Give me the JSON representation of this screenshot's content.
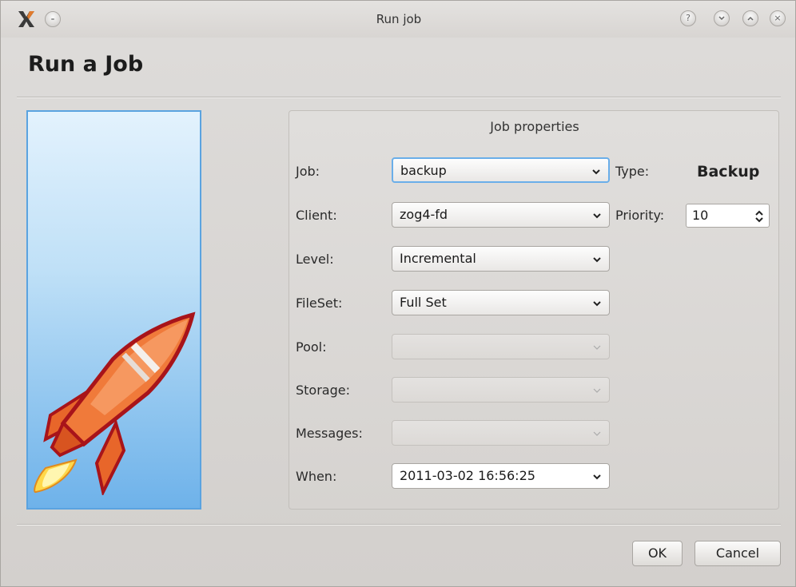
{
  "window": {
    "title": "Run job",
    "controls": [
      "help-icon",
      "minimize-icon",
      "maximize-icon",
      "close-icon"
    ],
    "help_glyph": "?",
    "close_glyph": "×"
  },
  "heading": "Run a Job",
  "properties": {
    "title": "Job properties",
    "job": {
      "label": "Job:",
      "value": "backup"
    },
    "type": {
      "label": "Type:",
      "value": "Backup"
    },
    "client": {
      "label": "Client:",
      "value": "zog4-fd"
    },
    "priority": {
      "label": "Priority:",
      "value": "10"
    },
    "level": {
      "label": "Level:",
      "value": "Incremental"
    },
    "fileset": {
      "label": "FileSet:",
      "value": "Full Set"
    },
    "pool": {
      "label": "Pool:",
      "value": ""
    },
    "storage": {
      "label": "Storage:",
      "value": ""
    },
    "messages": {
      "label": "Messages:",
      "value": ""
    },
    "when": {
      "label": "When:",
      "value": "2011-03-02 16:56:25"
    }
  },
  "buttons": {
    "ok": "OK",
    "cancel": "Cancel"
  },
  "colors": {
    "focus": "#6aaee9",
    "side_panel": "#8fc5ef",
    "rocket": "#f07a3a"
  }
}
